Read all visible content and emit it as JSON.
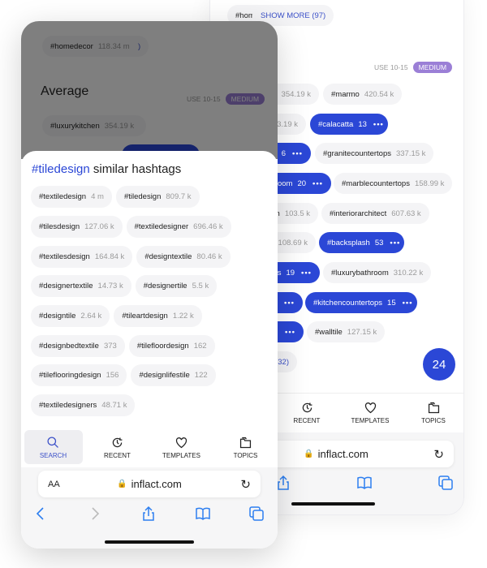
{
  "colors": {
    "accent": "#2b47d6",
    "badge": "#9b7fd6",
    "chip_bg": "#f4f4f6"
  },
  "back_screen": {
    "top_row": [
      {
        "name": "#homedecor",
        "count": "118.34 m"
      },
      {
        "more": "SHOW MORE (97)"
      }
    ],
    "use_label": "USE 10-15",
    "badge": "MEDIUM",
    "rows": [
      [
        {
          "name": "n",
          "count": "354.19 k"
        },
        {
          "name": "#marmo",
          "count": "420.54 k"
        }
      ],
      [
        {
          "name": "",
          "count": "53.19 k"
        },
        {
          "name": "#calacatta",
          "count": "13",
          "selected": true
        }
      ],
      [
        {
          "name": "",
          "count": "6",
          "selected": true
        },
        {
          "name": "#granitecountertops",
          "count": "337.15 k"
        }
      ],
      [
        {
          "name": "oom",
          "count": "20",
          "selected": true
        },
        {
          "name": "#marblecountertops",
          "count": "158.99 k"
        }
      ],
      [
        {
          "name": "en",
          "count": "103.5 k"
        },
        {
          "name": "#interiorarchitect",
          "count": "607.63 k"
        }
      ],
      [
        {
          "name": "",
          "count": "108.69 k"
        },
        {
          "name": "#backsplash",
          "count": "53",
          "selected": true
        }
      ],
      [
        {
          "name": "s",
          "count": "19",
          "selected": true
        },
        {
          "name": "#luxurybathroom",
          "count": "310.22 k"
        }
      ],
      [
        {
          "name": "",
          "count": "",
          "selected": true
        },
        {
          "name": "#kitchencountertops",
          "count": "15",
          "selected": true
        }
      ],
      [
        {
          "name": "",
          "count": "",
          "selected": true
        },
        {
          "name": "#walltile",
          "count": "127.15 k"
        }
      ],
      [
        {
          "more": "(32)"
        }
      ]
    ],
    "fab_count": "24",
    "nav": [
      {
        "label": "RECENT",
        "icon": "clock-icon"
      },
      {
        "label": "TEMPLATES",
        "icon": "heart-icon"
      },
      {
        "label": "TOPICS",
        "icon": "folder-icon"
      }
    ],
    "url": "inflact.com"
  },
  "front_screen": {
    "overlay": {
      "top_row": [
        {
          "name": "#homedecor",
          "count": "118.34 m"
        },
        {
          "more": "SHOW MORE (97)"
        }
      ],
      "section_title": "Average",
      "use_label": "USE 10-15",
      "badge": "MEDIUM",
      "row": [
        {
          "name": "#luxurykitchen",
          "count": "354.19 k"
        },
        {
          "name": "#marmo",
          "count": "420.54 k"
        }
      ]
    },
    "sheet": {
      "title_hashtag": "#tiledesign",
      "title_rest": " similar hashtags",
      "rows": [
        [
          {
            "name": "#textiledesign",
            "count": "4 m"
          },
          {
            "name": "#tiledesign",
            "count": "809.7 k"
          }
        ],
        [
          {
            "name": "#tilesdesign",
            "count": "127.06 k"
          },
          {
            "name": "#textiledesigner",
            "count": "696.46 k"
          }
        ],
        [
          {
            "name": "#textilesdesign",
            "count": "164.84 k"
          },
          {
            "name": "#designtextile",
            "count": "80.46 k"
          }
        ],
        [
          {
            "name": "#designertextile",
            "count": "14.73 k"
          },
          {
            "name": "#designertile",
            "count": "5.5 k"
          }
        ],
        [
          {
            "name": "#designtile",
            "count": "2.64 k"
          },
          {
            "name": "#tileartdesign",
            "count": "1.22 k"
          }
        ],
        [
          {
            "name": "#designbedtextile",
            "count": "373"
          },
          {
            "name": "#tilefloordesign",
            "count": "162"
          }
        ],
        [
          {
            "name": "#tileflooringdesign",
            "count": "156"
          },
          {
            "name": "#designlifestile",
            "count": "122"
          }
        ],
        [
          {
            "name": "#textiledesigners",
            "count": "48.71 k"
          }
        ]
      ]
    },
    "nav": [
      {
        "label": "SEARCH",
        "icon": "search-icon",
        "active": true
      },
      {
        "label": "RECENT",
        "icon": "clock-icon"
      },
      {
        "label": "TEMPLATES",
        "icon": "heart-icon"
      },
      {
        "label": "TOPICS",
        "icon": "folder-icon"
      }
    ],
    "text_size": "AA",
    "url": "inflact.com"
  }
}
